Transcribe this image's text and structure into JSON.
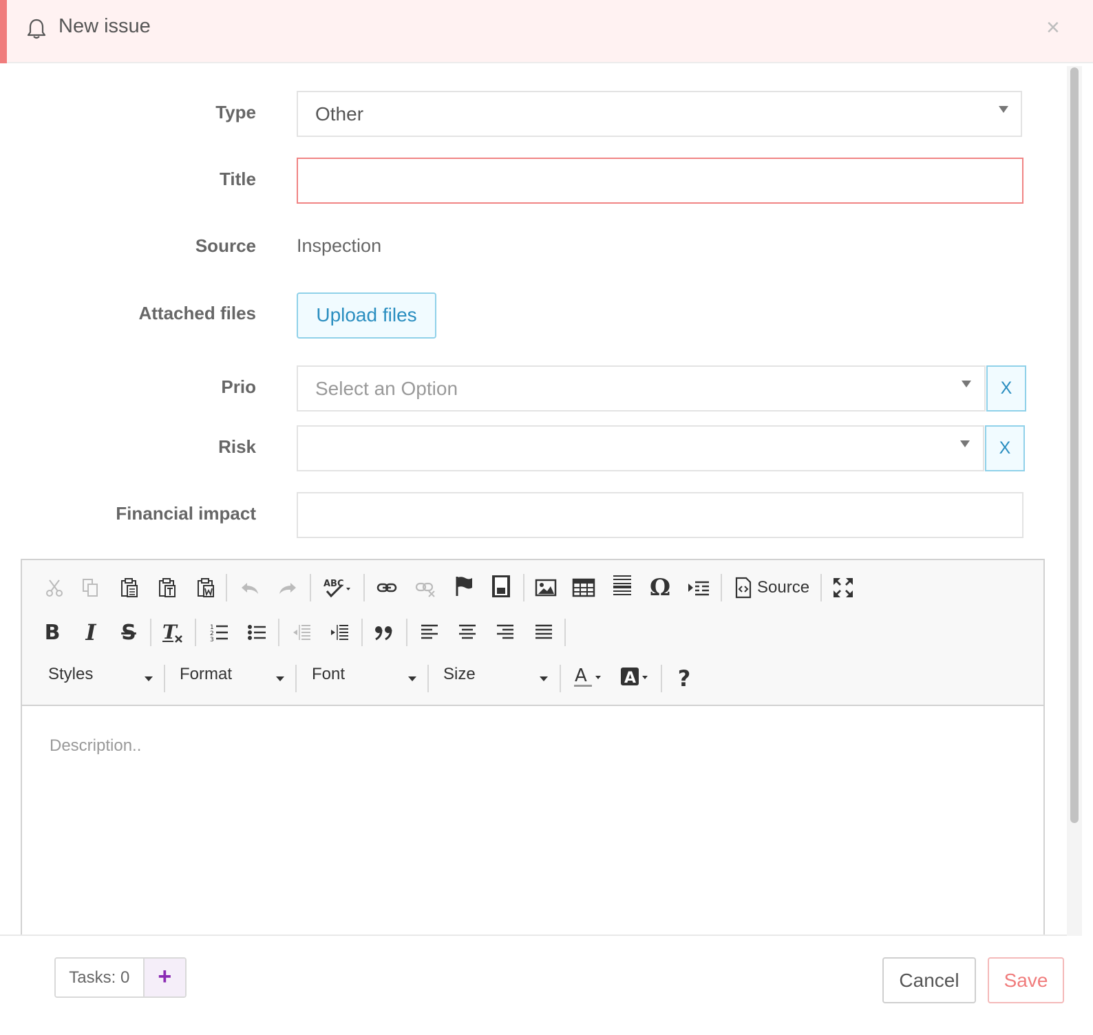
{
  "modal": {
    "title": "New issue",
    "close_symbol": "×",
    "icon": "bell-icon",
    "accent_color": "#f07c7c"
  },
  "form": {
    "type": {
      "label": "Type",
      "value": "Other"
    },
    "title": {
      "label": "Title",
      "value": ""
    },
    "source": {
      "label": "Source",
      "value": "Inspection"
    },
    "attached_files": {
      "label": "Attached files",
      "button": "Upload files"
    },
    "prio": {
      "label": "Prio",
      "placeholder": "Select an Option",
      "clear": "X"
    },
    "risk": {
      "label": "Risk",
      "value": "",
      "clear": "X"
    },
    "financial_impact": {
      "label": "Financial impact",
      "value": ""
    }
  },
  "editor": {
    "toolbar_row1": [
      "cut-icon",
      "copy-icon",
      "paste-icon",
      "paste-text-icon",
      "paste-word-icon",
      "undo-icon",
      "redo-icon",
      "spellcheck-icon",
      "link-icon",
      "unlink-icon",
      "anchor-icon",
      "iframe-icon",
      "image-icon",
      "table-icon",
      "horizontal-rule-icon",
      "special-char-icon",
      "show-blocks-icon",
      "source-icon",
      "maximize-icon"
    ],
    "source_label": "Source",
    "special_char_glyph": "Ω",
    "toolbar_row2": [
      "bold-icon",
      "italic-icon",
      "strikethrough-icon",
      "remove-format-icon",
      "numbered-list-icon",
      "bulleted-list-icon",
      "outdent-icon",
      "indent-icon",
      "blockquote-icon",
      "align-left-icon",
      "align-center-icon",
      "align-right-icon",
      "justify-icon"
    ],
    "glyphs": {
      "bold": "B",
      "italic": "I",
      "strike": "S",
      "clear_format": "T",
      "text_color": "A",
      "bg_color": "A",
      "help": "?",
      "quote": "❞"
    },
    "combos": {
      "styles": "Styles",
      "format": "Format",
      "font": "Font",
      "size": "Size"
    },
    "placeholder": "Description.."
  },
  "footer": {
    "tasks_label": "Tasks: 0",
    "add_symbol": "+",
    "cancel": "Cancel",
    "save": "Save"
  }
}
